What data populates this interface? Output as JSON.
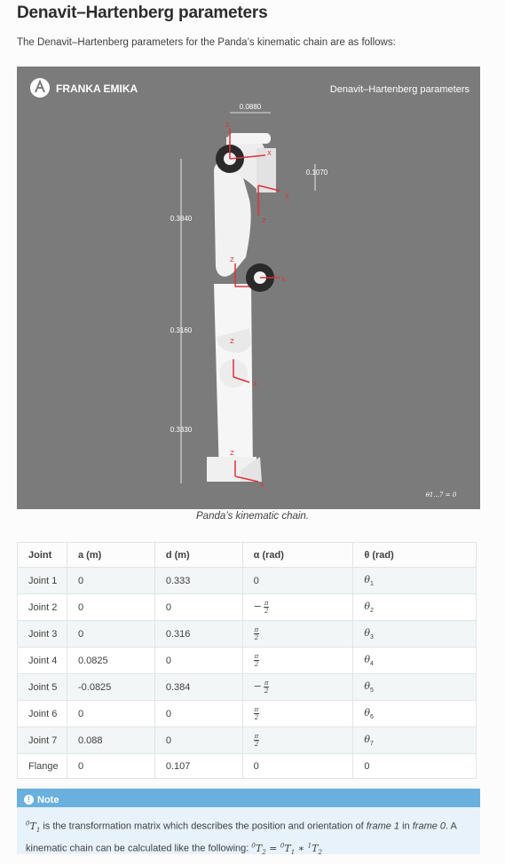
{
  "heading": "Denavit–Hartenberg parameters",
  "intro": "The Denavit–Hartenberg parameters for the Panda’s kinematic chain are as follows:",
  "figure": {
    "brand": "FRANKA EMIKA",
    "title": "Denavit–Hartenberg parameters",
    "dims": [
      "0.0880",
      "0.1070",
      "0.3840",
      "0.3160",
      "0.3330"
    ],
    "theta_note": "θ1...7 = 0",
    "caption": "Panda’s kinematic chain."
  },
  "table": {
    "headers": [
      "Joint",
      "a (m)",
      "d (m)",
      "α (rad)",
      "θ (rad)"
    ],
    "rows": [
      {
        "joint": "Joint 1",
        "a": "0",
        "d": "0.333",
        "alpha": "0",
        "alpha_frac": false,
        "alpha_neg": false,
        "theta": "θ",
        "theta_sub": "1"
      },
      {
        "joint": "Joint 2",
        "a": "0",
        "d": "0",
        "alpha": "π/2",
        "alpha_frac": true,
        "alpha_neg": true,
        "theta": "θ",
        "theta_sub": "2"
      },
      {
        "joint": "Joint 3",
        "a": "0",
        "d": "0.316",
        "alpha": "π/2",
        "alpha_frac": true,
        "alpha_neg": false,
        "theta": "θ",
        "theta_sub": "3"
      },
      {
        "joint": "Joint 4",
        "a": "0.0825",
        "d": "0",
        "alpha": "π/2",
        "alpha_frac": true,
        "alpha_neg": false,
        "theta": "θ",
        "theta_sub": "4"
      },
      {
        "joint": "Joint 5",
        "a": "-0.0825",
        "d": "0.384",
        "alpha": "π/2",
        "alpha_frac": true,
        "alpha_neg": true,
        "theta": "θ",
        "theta_sub": "5"
      },
      {
        "joint": "Joint 6",
        "a": "0",
        "d": "0",
        "alpha": "π/2",
        "alpha_frac": true,
        "alpha_neg": false,
        "theta": "θ",
        "theta_sub": "6"
      },
      {
        "joint": "Joint 7",
        "a": "0.088",
        "d": "0",
        "alpha": "π/2",
        "alpha_frac": true,
        "alpha_neg": false,
        "theta": "θ",
        "theta_sub": "7"
      },
      {
        "joint": "Flange",
        "a": "0",
        "d": "0.107",
        "alpha": "0",
        "alpha_frac": false,
        "alpha_neg": false,
        "theta": "0",
        "theta_sub": ""
      }
    ]
  },
  "note": {
    "label": "Note",
    "text_a": " is the transformation matrix which describes the position and orientation of ",
    "frame1": "frame 1",
    "text_b": " in ",
    "frame0": "frame 0",
    "text_c": ". A kinematic chain can be calculated like the following: "
  },
  "colors": {
    "note_header": "#6ab0de",
    "note_bg": "#e7f2fa",
    "figure_bg": "#7b7b7b",
    "axis_red": "#e0303c"
  }
}
